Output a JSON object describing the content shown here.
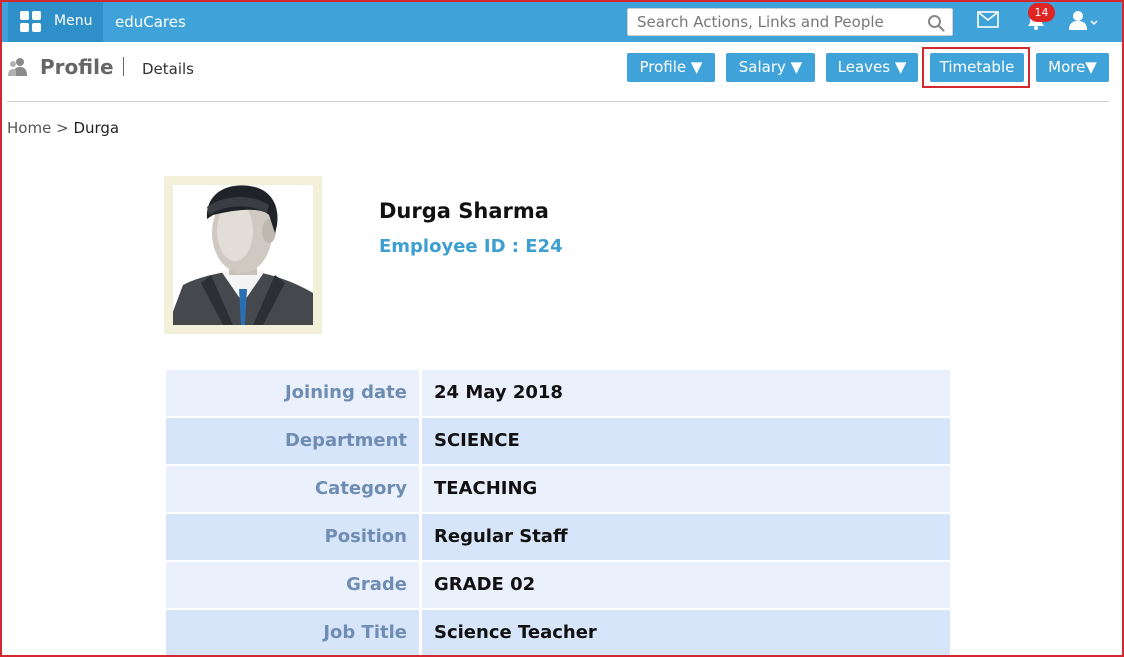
{
  "topbar": {
    "menu_label": "Menu",
    "brand": "eduCares",
    "search_placeholder": "Search Actions, Links and People",
    "notification_count": "14"
  },
  "page_header": {
    "title": "Profile",
    "subtitle": "Details",
    "actions": {
      "profile": "Profile ▼",
      "salary": "Salary ▼",
      "leaves": "Leaves ▼",
      "timetable": "Timetable",
      "more": "More▼"
    }
  },
  "breadcrumb": {
    "home": "Home",
    "separator": ">",
    "current": "Durga"
  },
  "employee": {
    "name": "Durga Sharma",
    "id_line": "Employee ID : E24"
  },
  "details": [
    {
      "label": "Joining date",
      "value": "24 May 2018"
    },
    {
      "label": "Department",
      "value": "SCIENCE"
    },
    {
      "label": "Category",
      "value": "TEACHING"
    },
    {
      "label": "Position",
      "value": "Regular Staff"
    },
    {
      "label": "Grade",
      "value": "GRADE 02"
    },
    {
      "label": "Job Title",
      "value": "Science Teacher"
    }
  ],
  "colors": {
    "accent": "#3fa3d9",
    "highlight_border": "#d3282f",
    "label_text": "#6f8db2",
    "row_light": "#eaf1fc",
    "row_dark": "#d7e5fa"
  }
}
